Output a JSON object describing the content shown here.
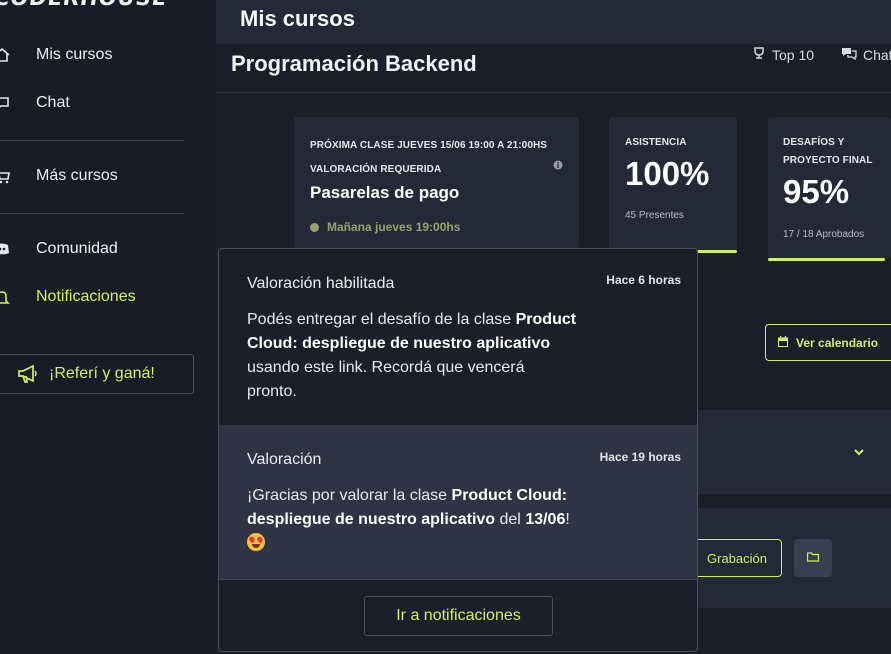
{
  "sidebar": {
    "brand": "CODERHOUSE",
    "items": [
      {
        "label": "Mis cursos",
        "icon": "home-icon"
      },
      {
        "label": "Chat",
        "icon": "chat-icon"
      },
      {
        "label": "Más cursos",
        "icon": "cart-icon"
      },
      {
        "label": "Comunidad",
        "icon": "discord-icon"
      },
      {
        "label": "Notificaciones",
        "icon": "bell-icon"
      }
    ],
    "refer_label": "¡Referí y ganá!"
  },
  "topbar": {
    "title": "Mis cursos"
  },
  "course": {
    "title": "Programación Backend",
    "top10_label": "Top 10",
    "chat_label": "Chat"
  },
  "cards": {
    "next_class": {
      "heading": "PRÓXIMA CLASE JUEVES 15/06 19:00 A 21:00HS",
      "rating": "VALORACIÓN REQUERIDA",
      "topic": "Pasarelas de pago",
      "when": "Mañana jueves 19:00hs"
    },
    "attendance": {
      "label": "ASISTENCIA",
      "value": "100%",
      "sub": "45 Presentes",
      "progress": 1.0
    },
    "challenges": {
      "label_line1": "DESAFÍOS Y",
      "label_line2": "PROYECTO FINAL",
      "value": "95%",
      "sub": "17 / 18 Aprobados",
      "progress": 0.95
    }
  },
  "calendar_button": "Ver calendario",
  "recording_button": "Grabación",
  "notifications": [
    {
      "title": "Valoración habilitada",
      "time": "Hace 6 horas",
      "body_pre": "Podés entregar el desafío de la clase ",
      "body_bold": "Product Cloud: despliegue de nuestro aplicativo",
      "body_post": " usando este link. Recordá que vencerá pronto."
    },
    {
      "title": "Valoración",
      "time": "Hace 19 horas",
      "body_pre": "¡Gracias por valorar la clase ",
      "body_bold": "Product Cloud: despliegue de nuestro aplicativo",
      "body_mid": " del ",
      "body_date": "13/06",
      "body_post": "!"
    }
  ],
  "notifications_button": "Ir a notificaciones",
  "colors": {
    "accent": "#cdf25a",
    "sidebar": "#191b26",
    "card": "#252836"
  }
}
